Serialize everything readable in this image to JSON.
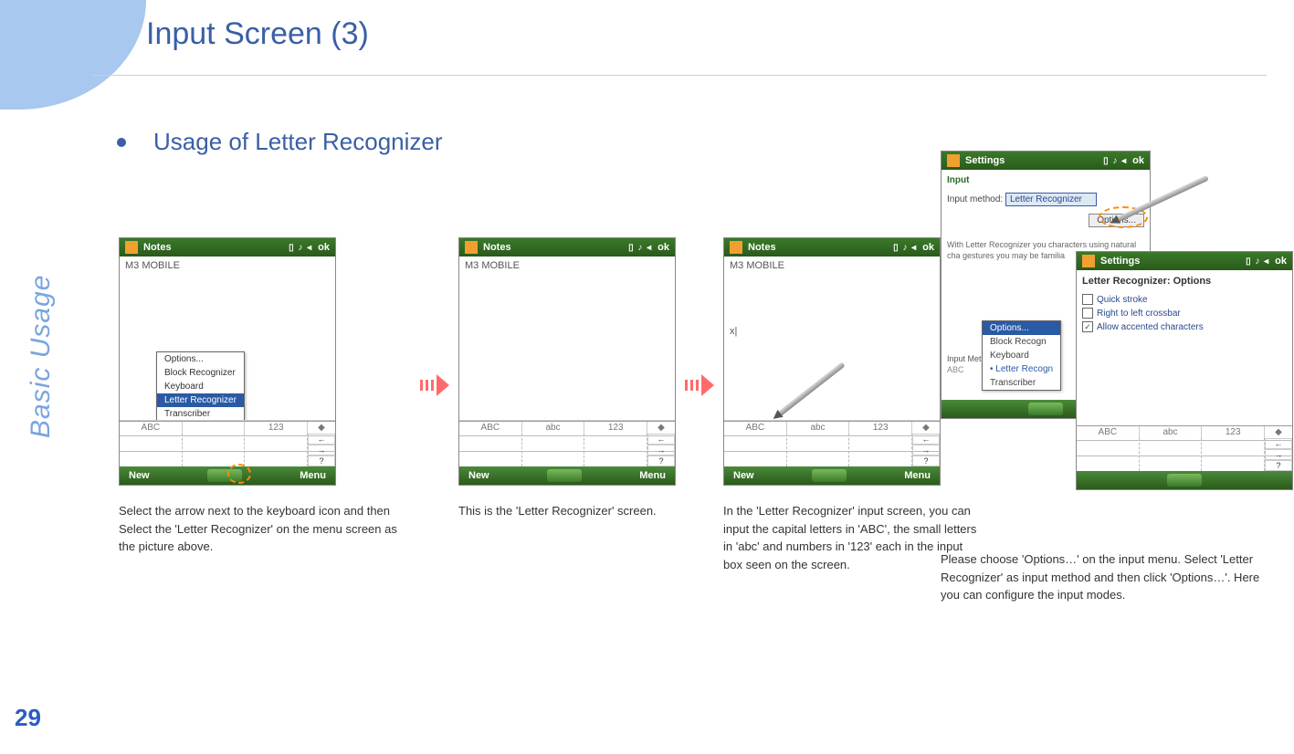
{
  "page": {
    "title": "Input Screen (3)",
    "side_label": "Basic Usage",
    "number": "29"
  },
  "bullet": "Usage of Letter Recognizer",
  "status_bar_text": "ok",
  "device_common": {
    "notes_title": "Notes",
    "body_text": "M3 MOBILE",
    "ime_zone_upper": "ABC",
    "ime_zone_lower": "abc",
    "ime_zone_num": "123",
    "bottom_new": "New",
    "bottom_menu": "Menu"
  },
  "step1": {
    "menu": {
      "items": [
        "Options...",
        "Block Recognizer",
        "Keyboard",
        "Letter Recognizer",
        "Transcriber"
      ],
      "selected_index": 3
    },
    "caption": "Select the arrow next to the keyboard icon and then Select the 'Letter Recognizer' on the menu screen as the picture above."
  },
  "step2": {
    "caption": "This is the 'Letter Recognizer' screen."
  },
  "step3": {
    "body_extra": "x|",
    "caption": "In the 'Letter Recognizer' input screen, you can input the capital letters in 'ABC', the small letters in 'abc' and numbers in '123' each in the input box seen on the screen."
  },
  "step4": {
    "settings_title": "Settings",
    "input_tab": "Input",
    "input_method_label": "Input method:",
    "input_method_value": "Letter Recognizer",
    "options_button": "Options...",
    "help_text": "With Letter Recognizer you characters using natural cha gestures you may be familia",
    "menu": {
      "items": [
        "Options...",
        "Block Recogn",
        "Keyboard",
        "Letter Recogn",
        "Transcriber"
      ],
      "selected_index": 0
    },
    "options_title": "Letter Recognizer: Options",
    "checkboxes": [
      {
        "label": "Quick stroke",
        "checked": false
      },
      {
        "label": "Right to left crossbar",
        "checked": false
      },
      {
        "label": "Allow accented characters",
        "checked": true
      }
    ],
    "caption": "Please choose 'Options…' on the input menu. Select 'Letter Recognizer' as input method and then click 'Options…'. Here you can configure the input modes."
  }
}
